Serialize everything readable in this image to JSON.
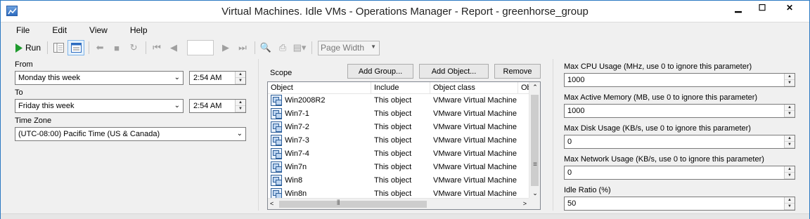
{
  "window": {
    "title": "Virtual Machines. Idle VMs - Operations Manager - Report - greenhorse_group"
  },
  "menu": [
    "File",
    "Edit",
    "View",
    "Help"
  ],
  "toolbar": {
    "run_label": "Run",
    "zoom_value": "Page Width",
    "page_value": ""
  },
  "params": {
    "from_label": "From",
    "from_date": "Monday this week",
    "from_time": "2:54 AM",
    "to_label": "To",
    "to_date": "Friday this week",
    "to_time": "2:54 AM",
    "timezone_label": "Time Zone",
    "timezone_value": "(UTC-08:00) Pacific Time (US & Canada)"
  },
  "scope": {
    "label": "Scope",
    "add_group": "Add Group...",
    "add_object": "Add Object...",
    "remove": "Remove",
    "columns": [
      "Object",
      "Include",
      "Object class",
      "Ob"
    ],
    "rows": [
      {
        "object": "Win2008R2",
        "include": "This object",
        "class": "VMware Virtual Machine"
      },
      {
        "object": "Win7-1",
        "include": "This object",
        "class": "VMware Virtual Machine"
      },
      {
        "object": "Win7-2",
        "include": "This object",
        "class": "VMware Virtual Machine"
      },
      {
        "object": "Win7-3",
        "include": "This object",
        "class": "VMware Virtual Machine"
      },
      {
        "object": "Win7-4",
        "include": "This object",
        "class": "VMware Virtual Machine"
      },
      {
        "object": "Win7n",
        "include": "This object",
        "class": "VMware Virtual Machine"
      },
      {
        "object": "Win8",
        "include": "This object",
        "class": "VMware Virtual Machine"
      },
      {
        "object": "Win8n",
        "include": "This object",
        "class": "VMware Virtual Machine"
      }
    ]
  },
  "thresholds": [
    {
      "label": "Max CPU Usage (MHz, use 0 to ignore this parameter)",
      "value": "1000"
    },
    {
      "label": "Max Active Memory (MB, use 0 to ignore this parameter)",
      "value": "1000"
    },
    {
      "label": "Max Disk Usage (KB/s, use 0 to ignore this parameter)",
      "value": "0"
    },
    {
      "label": "Max Network Usage (KB/s, use 0 to ignore this parameter)",
      "value": "0"
    },
    {
      "label": "Idle Ratio (%)",
      "value": "50"
    }
  ]
}
